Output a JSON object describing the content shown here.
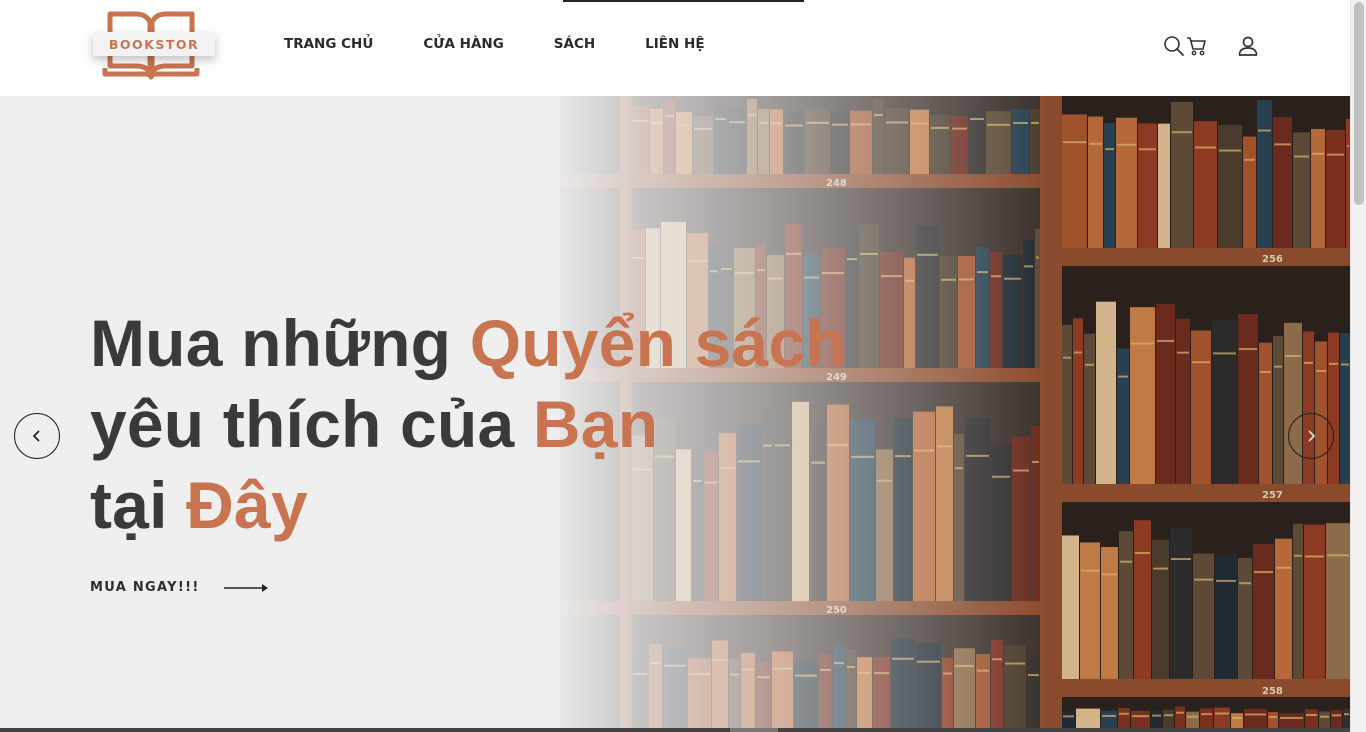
{
  "brand": {
    "logo_text": "BOOKSTOR",
    "accent_color": "#c97450"
  },
  "nav": {
    "items": [
      {
        "label": "TRANG CHỦ"
      },
      {
        "label": "CỬA HÀNG"
      },
      {
        "label": "SÁCH"
      },
      {
        "label": "LIÊN HỆ"
      }
    ]
  },
  "header_icons": [
    "search-icon",
    "cart-icon",
    "user-icon"
  ],
  "hero": {
    "line1_plain": "Mua những ",
    "line1_accent": "Quyển sách",
    "line2_plain": "yêu thích của ",
    "line2_accent": "Bạn",
    "line3_plain": "tại ",
    "line3_accent": "Đây",
    "cta_label": "MUA NGAY!!!",
    "shelf_numbers": [
      "248",
      "256",
      "249",
      "257",
      "250",
      "258"
    ]
  },
  "slider": {
    "prev_icon": "chevron-left-icon",
    "next_icon": "chevron-right-icon"
  }
}
